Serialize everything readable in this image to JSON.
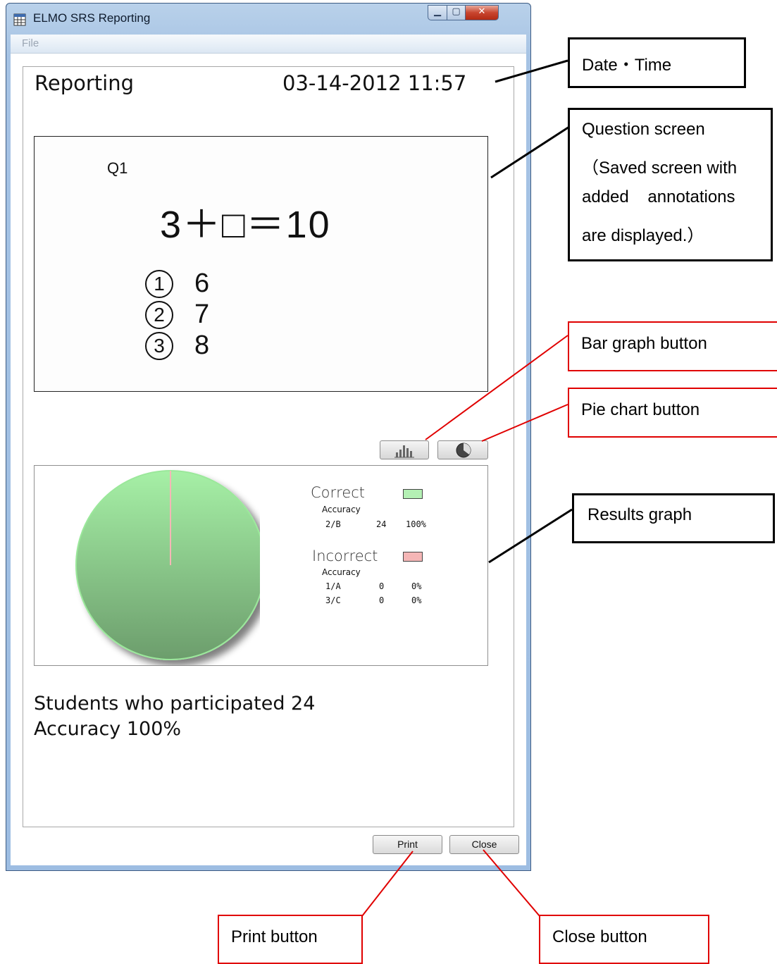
{
  "window": {
    "title": "ELMO SRS Reporting",
    "menu": [
      "File"
    ],
    "controls": {
      "minimize": "▁",
      "maximize": "▢",
      "close": "✕"
    }
  },
  "report": {
    "title": "Reporting",
    "datetime": "03-14-2012  11:57",
    "question": {
      "label": "Q1",
      "equation": "3＋□＝10",
      "options": [
        {
          "num": "1",
          "value": "6"
        },
        {
          "num": "2",
          "value": "7"
        },
        {
          "num": "3",
          "value": "8"
        }
      ]
    },
    "results": {
      "correct": {
        "title": "Correct",
        "color": "#b4f0b4",
        "sub": "Accuracy",
        "rows": [
          [
            "2/B",
            "24",
            "100%"
          ]
        ]
      },
      "incorrect": {
        "title": "Incorrect",
        "color": "#f5b6b6",
        "sub": "Accuracy",
        "rows": [
          [
            "1/A",
            "0",
            "0%"
          ],
          [
            "3/C",
            "0",
            "0%"
          ]
        ]
      }
    },
    "summary": {
      "participants": "Students who participated 24",
      "accuracy": "Accuracy 100%"
    }
  },
  "buttons": {
    "print": "Print",
    "close": "Close"
  },
  "chart_data": {
    "type": "pie",
    "categories": [
      "Correct",
      "Incorrect"
    ],
    "values": [
      100,
      0
    ]
  },
  "callouts": {
    "datetime": "Date・Time",
    "question_screen": [
      "Question screen",
      "（Saved screen with",
      "added    annotations",
      "are displayed.）"
    ],
    "bar_graph": "Bar graph button",
    "pie_chart": "Pie chart button",
    "results_graph": "Results graph",
    "print": "Print button",
    "close": "Close button"
  }
}
